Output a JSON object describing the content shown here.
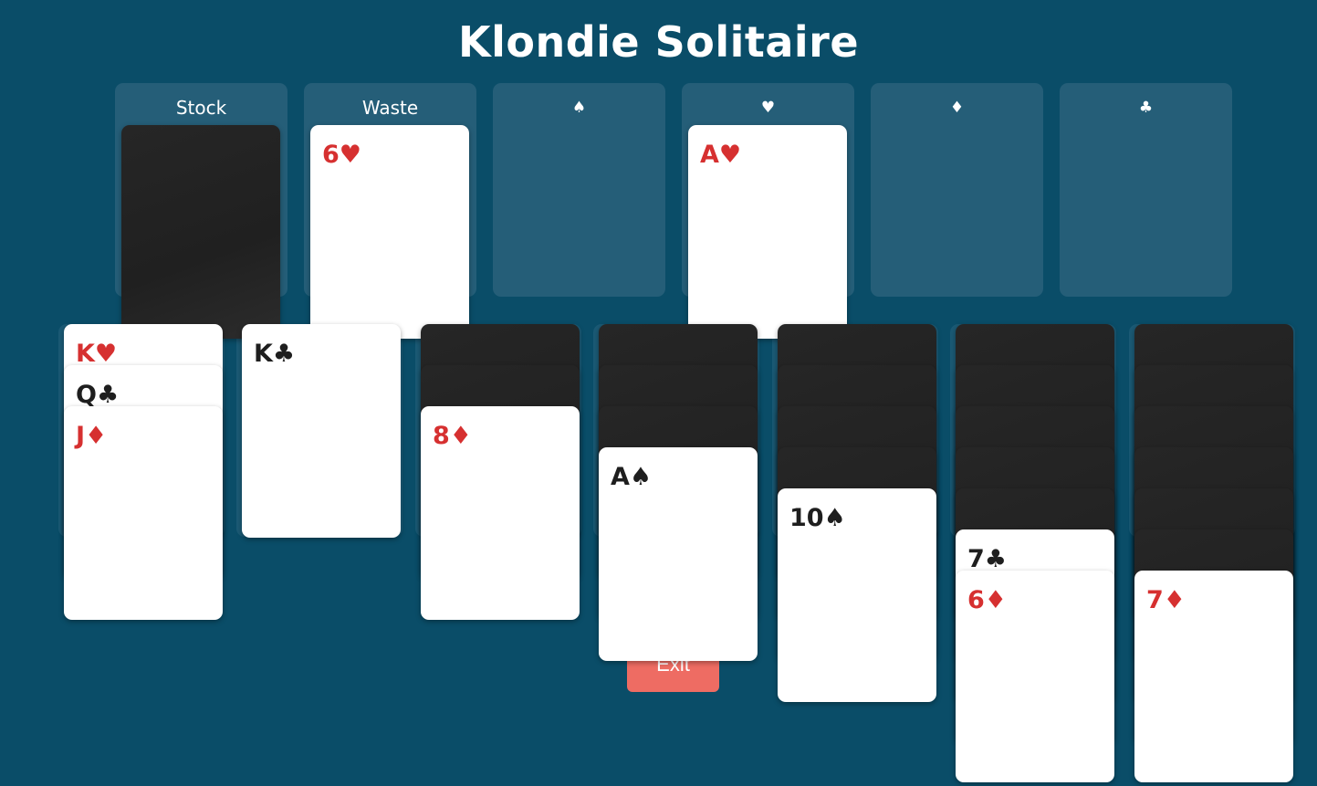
{
  "title": "Klondie Solitaire",
  "top_slots": [
    {
      "label": "Stock"
    },
    {
      "label": "Waste"
    },
    {
      "label": "♠"
    },
    {
      "label": "♥"
    },
    {
      "label": "♦"
    },
    {
      "label": "♣"
    }
  ],
  "stock": {
    "face_down": true
  },
  "waste": {
    "top_card": {
      "rank": "6♥",
      "color": "red"
    }
  },
  "foundations": {
    "spades": null,
    "hearts": {
      "rank": "A♥",
      "color": "red"
    },
    "diamonds": null,
    "clubs": null
  },
  "tableau": [
    {
      "hidden": 0,
      "face_up": [
        {
          "rank": "K♥",
          "color": "red"
        },
        {
          "rank": "Q♣",
          "color": "black"
        },
        {
          "rank": "J♦",
          "color": "red"
        }
      ]
    },
    {
      "hidden": 0,
      "face_up": [
        {
          "rank": "K♣",
          "color": "black"
        }
      ]
    },
    {
      "hidden": 2,
      "face_up": [
        {
          "rank": "8♦",
          "color": "red"
        }
      ]
    },
    {
      "hidden": 3,
      "face_up": [
        {
          "rank": "A♠",
          "color": "black"
        }
      ]
    },
    {
      "hidden": 4,
      "face_up": [
        {
          "rank": "10♠",
          "color": "black"
        }
      ]
    },
    {
      "hidden": 5,
      "face_up": [
        {
          "rank": "7♣",
          "color": "black"
        },
        {
          "rank": "6♦",
          "color": "red"
        }
      ]
    },
    {
      "hidden": 6,
      "face_up": [
        {
          "rank": "7♦",
          "color": "red"
        }
      ]
    }
  ],
  "exit_button": {
    "label": "Exit"
  },
  "colors": {
    "background": "#0a4d68",
    "slot": "#255e78",
    "red_suit": "#d63030",
    "black_suit": "#1e1e1e",
    "exit": "#ee6c63",
    "card_back": "#242424"
  }
}
